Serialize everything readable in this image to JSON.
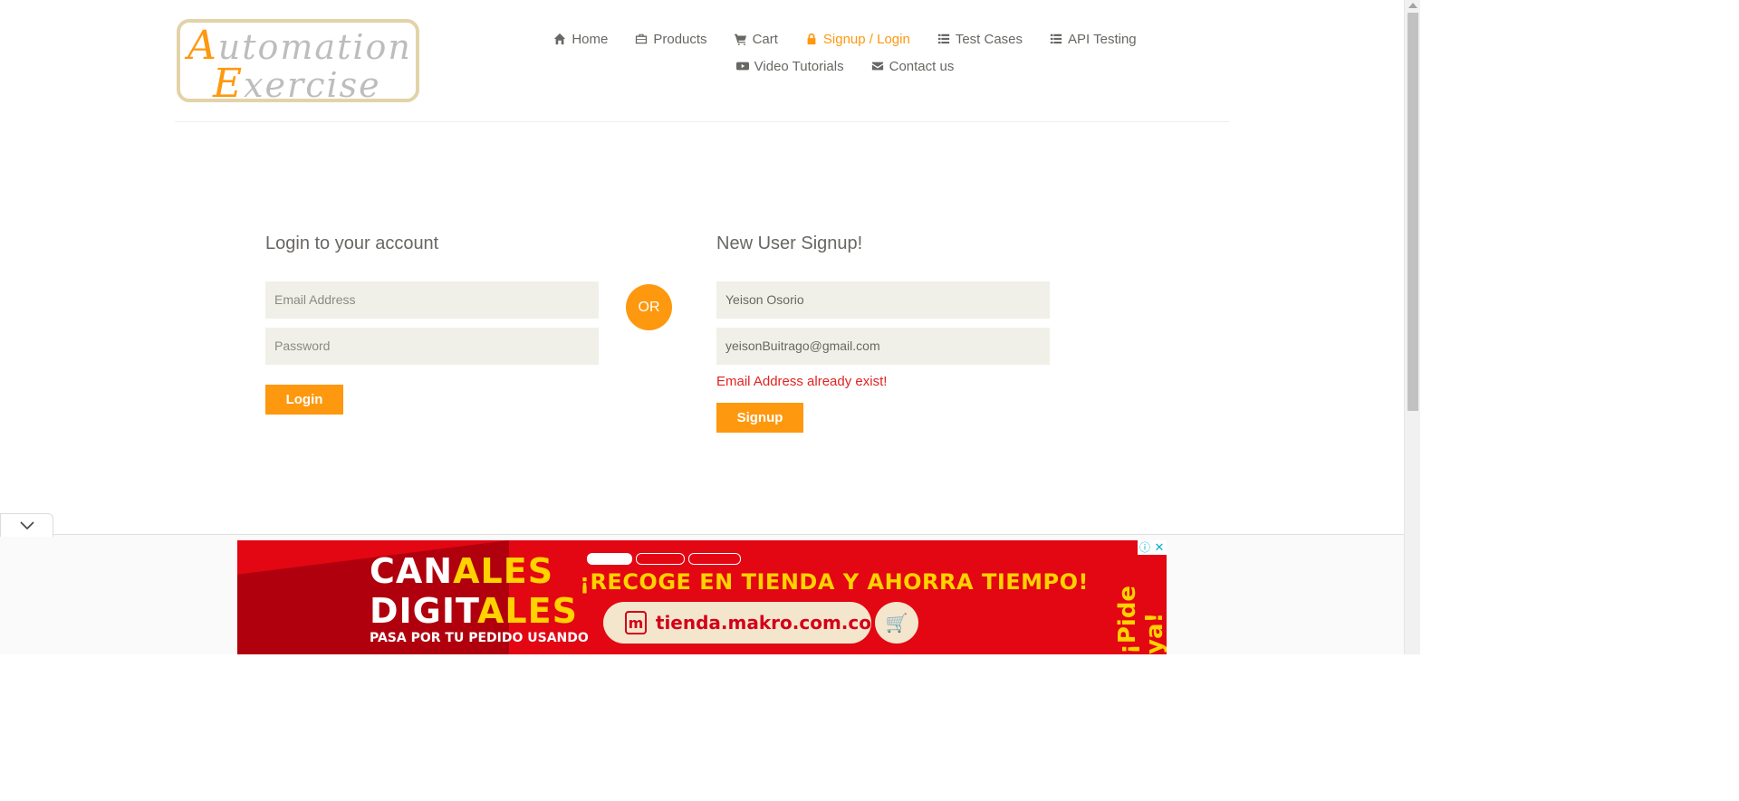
{
  "brand": {
    "logo_line1_cap": "A",
    "logo_line1_rest": "utomation",
    "logo_line2_cap": "E",
    "logo_line2_rest": "xercise",
    "accent_color": "#fe980f"
  },
  "nav": {
    "row1": [
      {
        "label": "Home",
        "icon": "home-icon"
      },
      {
        "label": "Products",
        "icon": "briefcase-icon"
      },
      {
        "label": "Cart",
        "icon": "cart-icon"
      },
      {
        "label": "Signup / Login",
        "icon": "lock-icon",
        "active": true
      },
      {
        "label": "Test Cases",
        "icon": "list-icon"
      },
      {
        "label": "API Testing",
        "icon": "list-icon"
      }
    ],
    "row2": [
      {
        "label": "Video Tutorials",
        "icon": "youtube-play-icon"
      },
      {
        "label": "Contact us",
        "icon": "envelope-icon"
      }
    ]
  },
  "login": {
    "title": "Login to your account",
    "email_placeholder": "Email Address",
    "password_placeholder": "Password",
    "button": "Login"
  },
  "or_label": "OR",
  "signup": {
    "title": "New User Signup!",
    "name_value": "Yeison Osorio",
    "email_value": "yeisonBuitrago@gmail.com",
    "error": "Email Address already exist!",
    "button": "Signup",
    "error_color": "#e32222"
  },
  "ad": {
    "line1_a": "CAN",
    "line1_b": "ALES",
    "line2_a": "DIGIT",
    "line2_b": "ALES",
    "line3": "PASA POR TU PEDIDO USANDO",
    "headline": "¡RECOGE EN TIENDA Y AHORRA TIEMPO!",
    "url": "tienda.makro.com.co",
    "side": "¡Pide ya!",
    "info_icon": "info-icon",
    "close_icon": "close-icon"
  }
}
